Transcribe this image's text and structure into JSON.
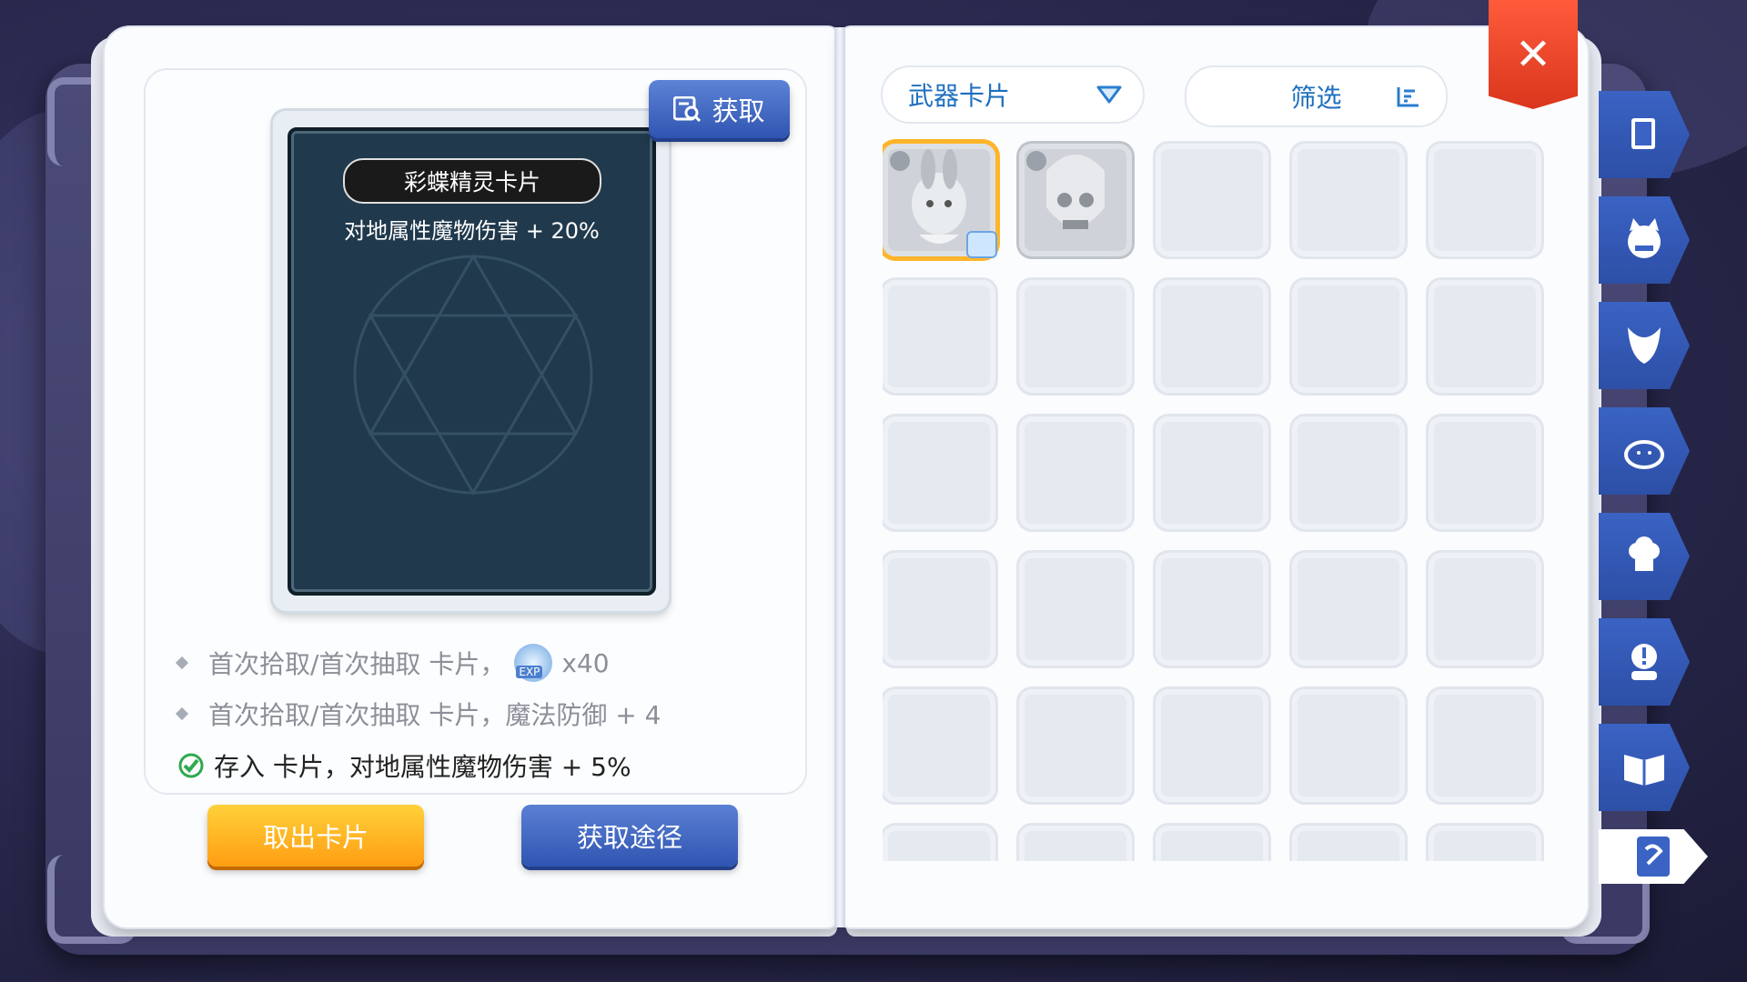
{
  "left_page": {
    "get_button_label": "获取",
    "card": {
      "name": "彩蝶精灵卡片",
      "effect": "对地属性魔物伤害 + 20%"
    },
    "bullets": [
      {
        "text": "首次拾取/首次抽取 卡片，",
        "reward_icon": "exp-orb-icon",
        "reward_badge": "EXP",
        "reward_amount": "x40"
      },
      {
        "text": "首次拾取/首次抽取 卡片，魔法防御 + 4"
      }
    ],
    "stored_bonus": "存入 卡片，对地属性魔物伤害 + 5%",
    "take_out_button": "取出卡片",
    "acquire_path_button": "获取途径"
  },
  "right_page": {
    "category_select": {
      "value": "武器卡片",
      "icon": "triangle-down-icon"
    },
    "filter_label": "筛选",
    "filter_icon": "filter-icon",
    "slots": [
      {
        "state": "owned",
        "selected": true,
        "icon": "bunny-card-icon",
        "badge": "inbox-icon"
      },
      {
        "state": "unowned",
        "selected": false,
        "icon": "skull-card-icon"
      }
    ]
  },
  "close_icon": "close-icon",
  "side_tabs": [
    {
      "icon": "book-icon"
    },
    {
      "icon": "cat-face-icon"
    },
    {
      "icon": "horned-helmet-icon"
    },
    {
      "icon": "slime-icon"
    },
    {
      "icon": "chef-hat-icon"
    },
    {
      "icon": "alert-head-icon"
    },
    {
      "icon": "open-book-icon"
    },
    {
      "icon": "card-album-icon",
      "active": true
    }
  ],
  "colors": {
    "accent_blue": "#2f55b2",
    "accent_orange": "#ff9d12",
    "close_red": "#d9361d",
    "selected_gold": "#ffb52a"
  }
}
